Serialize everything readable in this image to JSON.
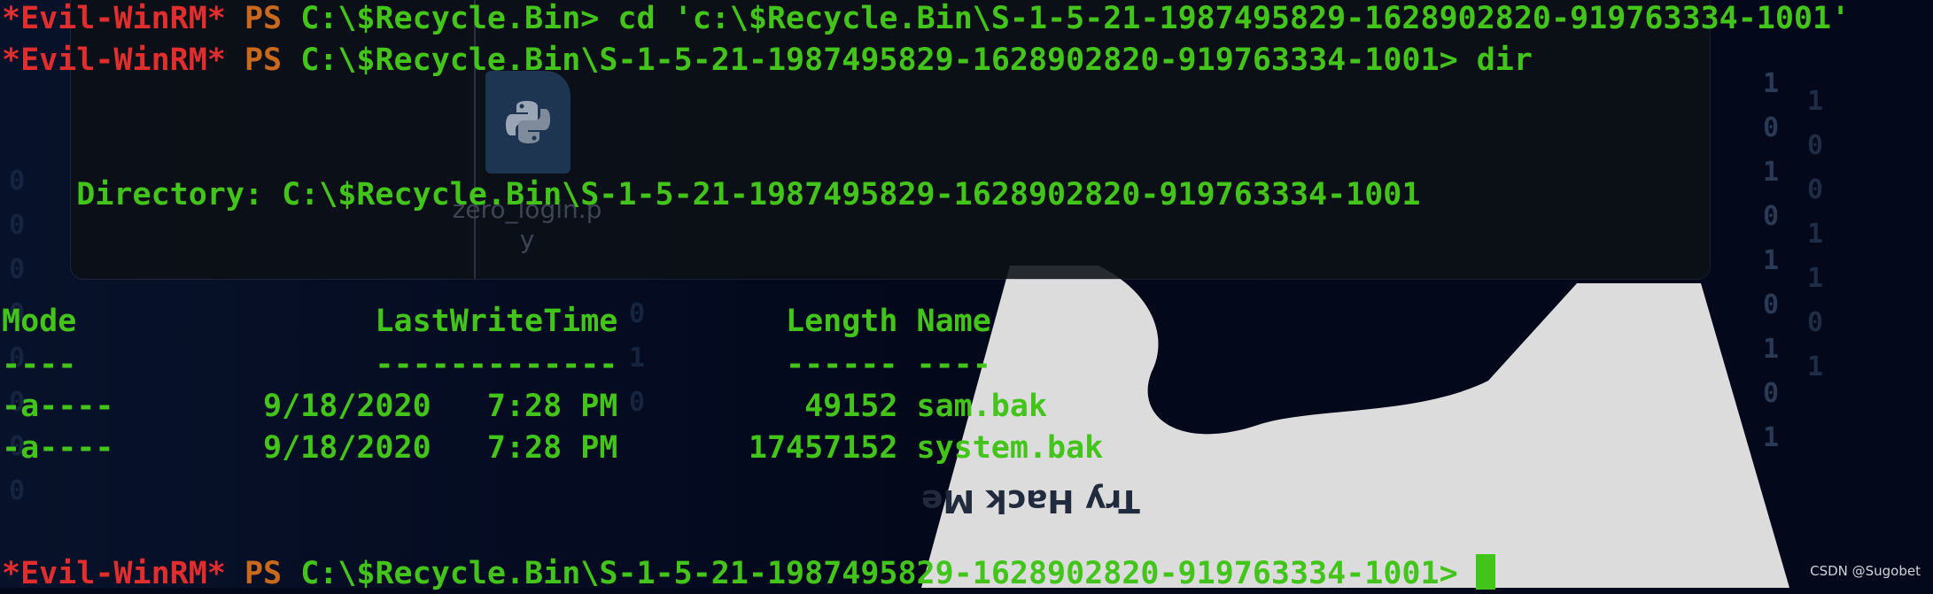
{
  "terminal": {
    "prompt_tag": "*Evil-WinRM*",
    "prompt_ps": "PS",
    "line1_path": "C:\\$Recycle.Bin>",
    "line1_cmd": " cd 'c:\\$Recycle.Bin\\S-1-5-21-1987495829-1628902820-919763334-1001'",
    "line2_path": "C:\\$Recycle.Bin\\S-1-5-21-1987495829-1628902820-919763334-1001>",
    "line2_cmd": " dir",
    "directory_line": "    Directory: C:\\$Recycle.Bin\\S-1-5-21-1987495829-1628902820-919763334-1001",
    "table": {
      "header": "Mode                LastWriteTime         Length Name",
      "separator": "----                -------------         ------ ----",
      "rows": [
        "-a----        9/18/2020   7:28 PM          49152 sam.bak",
        "-a----        9/18/2020   7:28 PM       17457152 system.bak"
      ]
    },
    "last_path": "C:\\$Recycle.Bin\\S-1-5-21-1987495829-1628902820-919763334-1001>"
  },
  "background": {
    "file_icon_label": "zero_login.p\ny",
    "file_icon_name": "python-file-icon",
    "logo_text": "Try Hack Me"
  },
  "credit": "CSDN @Sugobet",
  "colors": {
    "prompt_red": "#e02d2d",
    "prompt_orange": "#c9691e",
    "text_green": "#43c41a",
    "background": "#03081a"
  }
}
